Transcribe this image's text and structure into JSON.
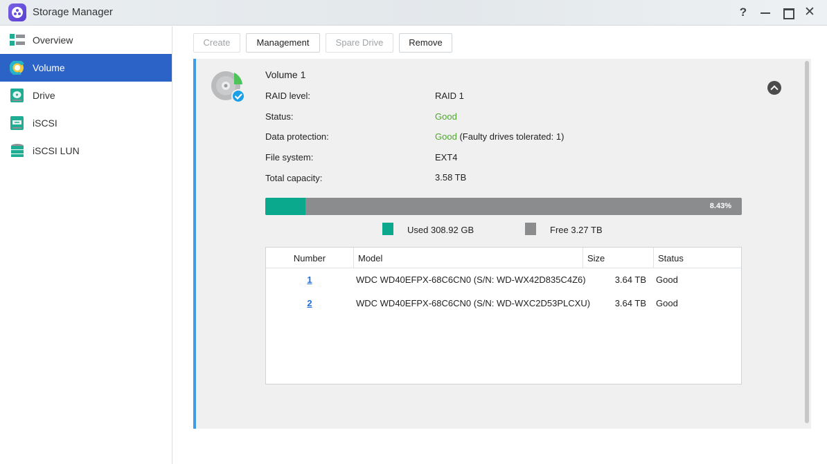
{
  "window": {
    "title": "Storage Manager",
    "controls": {
      "help": "?",
      "close": "✕"
    }
  },
  "sidebar": {
    "items": [
      {
        "label": "Overview",
        "icon": "overview-icon",
        "active": false
      },
      {
        "label": "Volume",
        "icon": "volume-icon",
        "active": true
      },
      {
        "label": "Drive",
        "icon": "drive-icon",
        "active": false
      },
      {
        "label": "iSCSI",
        "icon": "iscsi-icon",
        "active": false
      },
      {
        "label": "iSCSI LUN",
        "icon": "iscsi-lun-icon",
        "active": false
      }
    ]
  },
  "toolbar": {
    "create": "Create",
    "management": "Management",
    "spare_drive": "Spare Drive",
    "remove": "Remove"
  },
  "volume": {
    "name": "Volume 1",
    "details": [
      {
        "label": "RAID level:",
        "value": "RAID 1"
      },
      {
        "label": "Status:",
        "value": "Good"
      },
      {
        "label": "Data protection:",
        "value": "Good",
        "extra": "(Faulty drives tolerated: 1)"
      },
      {
        "label": "File system:",
        "value": "EXT4"
      },
      {
        "label": "Total capacity:",
        "value": "3.58 TB"
      }
    ],
    "usage": {
      "percent": 8.43,
      "percent_label": "8.43%",
      "used_label": "Used 308.92 GB",
      "free_label": "Free 3.27 TB",
      "used_color": "#0aa88c",
      "free_color": "#8a8c8e"
    },
    "status_color": "#4ea72e"
  },
  "drive_table": {
    "columns": [
      "Number",
      "Model",
      "Size",
      "Status"
    ],
    "rows": [
      {
        "number": "1",
        "model": "WDC WD40EFPX-68C6CN0 (S/N: WD-WX42D835C4Z6)",
        "size": "3.64 TB",
        "status": "Good"
      },
      {
        "number": "2",
        "model": "WDC WD40EFPX-68C6CN0 (S/N: WD-WXC2D53PLCXU)",
        "size": "3.64 TB",
        "status": "Good"
      }
    ]
  },
  "colors": {
    "accent": "#2b63c6",
    "panel_border": "#3f9de8",
    "link": "#1e6ed9"
  }
}
